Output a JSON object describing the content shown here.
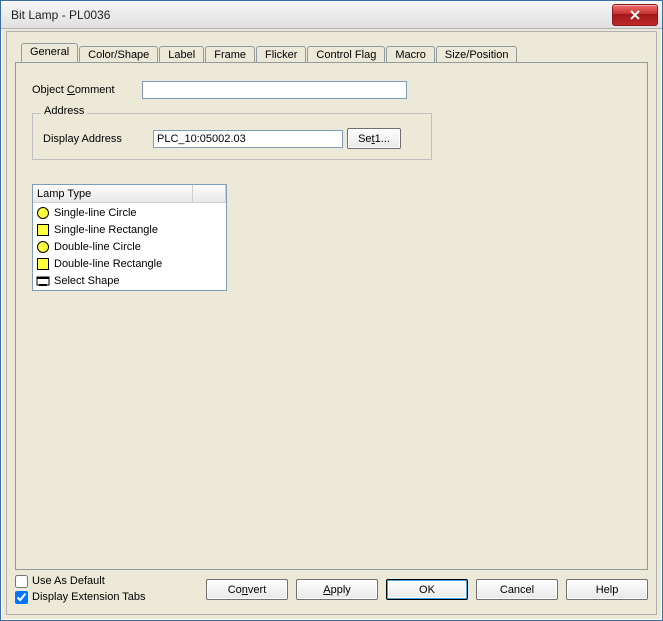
{
  "window": {
    "title": "Bit Lamp - PL0036"
  },
  "tabs": {
    "general": "General",
    "color_shape": "Color/Shape",
    "label": "Label",
    "frame": "Frame",
    "flicker": "Flicker",
    "control_flag": "Control Flag",
    "macro": "Macro",
    "size_position": "Size/Position"
  },
  "general": {
    "object_comment_label_pre": "Object ",
    "object_comment_label_ul": "C",
    "object_comment_label_post": "omment",
    "object_comment_value": ""
  },
  "address": {
    "legend": "Address",
    "display_address_label": "Display Address",
    "display_address_value": "PLC_10:05002.03",
    "set_label_pre": "Se",
    "set_label_ul": "t",
    "set_label_post": "1..."
  },
  "lamp_type": {
    "header": "Lamp Type",
    "items": [
      "Single-line Circle",
      "Single-line Rectangle",
      "Double-line Circle",
      "Double-line Rectangle",
      "Select Shape"
    ]
  },
  "footer": {
    "use_as_default_pre": "Use As ",
    "use_as_default_ul": "D",
    "use_as_default_post": "efault",
    "display_ext_pre": "Display Extension ",
    "display_ext_ul": "T",
    "display_ext_post": "abs",
    "convert_pre": "Co",
    "convert_ul": "n",
    "convert_post": "vert",
    "apply_ul": "A",
    "apply_post": "pply",
    "ok": "OK",
    "cancel": "Cancel",
    "help": "Help"
  }
}
